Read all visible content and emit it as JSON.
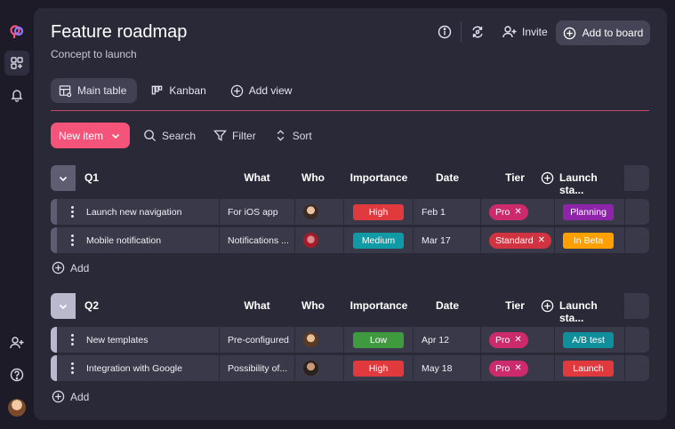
{
  "header": {
    "title": "Feature roadmap",
    "subtitle": "Concept to launch",
    "invite_label": "Invite",
    "add_to_board_label": "Add to board"
  },
  "tabs": [
    {
      "label": "Main table",
      "active": true
    },
    {
      "label": "Kanban",
      "active": false
    },
    {
      "label": "Add view",
      "active": false
    }
  ],
  "toolbar": {
    "new_item_label": "New item",
    "search_label": "Search",
    "filter_label": "Filter",
    "sort_label": "Sort"
  },
  "columns": {
    "what": "What",
    "who": "Who",
    "importance": "Importance",
    "date": "Date",
    "tier": "Tier",
    "launch_status": "Launch sta..."
  },
  "groups": [
    {
      "name": "Q1",
      "toggle_color": "#5e5d72",
      "rows": [
        {
          "name": "Launch new navigation",
          "what": "For iOS app",
          "importance": "High",
          "importance_color": "#e03a3e",
          "date": "Feb 1",
          "tier": "Pro",
          "tier_color": "#cc2a6b",
          "status": "Planning",
          "status_color": "#8e24aa",
          "stripe_color": "#5e5d72"
        },
        {
          "name": "Mobile notification",
          "what": "Notifications ...",
          "importance": "Medium",
          "importance_color": "#0f9aa6",
          "date": "Mar 17",
          "tier": "Standard",
          "tier_color": "#d13440",
          "status": "In Beta",
          "status_color": "#ff9f00",
          "stripe_color": "#5e5d72"
        }
      ],
      "add_label": "Add"
    },
    {
      "name": "Q2",
      "toggle_color": "#b9b8cc",
      "rows": [
        {
          "name": "New templates",
          "what": "Pre-configured...",
          "importance": "Low",
          "importance_color": "#3f9a3f",
          "date": "Apr 12",
          "tier": "Pro",
          "tier_color": "#cc2a6b",
          "status": "A/B test",
          "status_color": "#0f8f9c",
          "stripe_color": "#b9b8cc"
        },
        {
          "name": "Integration with Google",
          "what": "Possibility of...",
          "importance": "High",
          "importance_color": "#e03a3e",
          "date": "May 18",
          "tier": "Pro",
          "tier_color": "#cc2a6b",
          "status": "Launch",
          "status_color": "#e03a3e",
          "stripe_color": "#b9b8cc"
        }
      ],
      "add_label": "Add"
    }
  ]
}
